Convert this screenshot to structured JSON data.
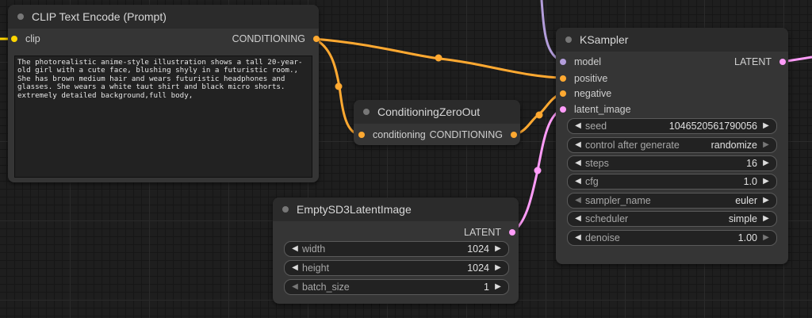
{
  "nodes": {
    "clip_text_encode": {
      "title": "CLIP Text Encode (Prompt)",
      "input_clip": "clip",
      "output": "CONDITIONING",
      "prompt_text": "The photorealistic anime-style illustration shows a tall 20-year-old girl with a cute face, blushing shyly in a futuristic room., She has brown medium hair and wears futuristic headphones and glasses. She wears a white taut shirt and black micro shorts. extremely detailed background,full body,"
    },
    "conditioning_zero_out": {
      "title": "ConditioningZeroOut",
      "input": "conditioning",
      "output": "CONDITIONING"
    },
    "empty_latent": {
      "title": "EmptySD3LatentImage",
      "output": "LATENT",
      "widgets": {
        "width": {
          "label": "width",
          "value": "1024"
        },
        "height": {
          "label": "height",
          "value": "1024"
        },
        "batch_size": {
          "label": "batch_size",
          "value": "1"
        }
      }
    },
    "ksampler": {
      "title": "KSampler",
      "inputs": {
        "model": "model",
        "positive": "positive",
        "negative": "negative",
        "latent_image": "latent_image"
      },
      "output": "LATENT",
      "widgets": {
        "seed": {
          "label": "seed",
          "value": "1046520561790056"
        },
        "control_after_generate": {
          "label": "control after generate",
          "value": "randomize"
        },
        "steps": {
          "label": "steps",
          "value": "16"
        },
        "cfg": {
          "label": "cfg",
          "value": "1.0"
        },
        "sampler_name": {
          "label": "sampler_name",
          "value": "euler"
        },
        "scheduler": {
          "label": "scheduler",
          "value": "simple"
        },
        "denoise": {
          "label": "denoise",
          "value": "1.00"
        }
      }
    }
  },
  "icons": {
    "decrement": "left-arrow-icon",
    "increment": "right-arrow-icon",
    "node_status": "dot-icon"
  },
  "colors": {
    "conditioning_link": "#ffa931",
    "clip_pin": "#ffd500",
    "model_link": "#b39ddb",
    "latent_link": "#ff9cf9",
    "node_bg": "#353535",
    "title_bg": "#2b2b2b",
    "canvas_bg": "#1e1e1e"
  }
}
